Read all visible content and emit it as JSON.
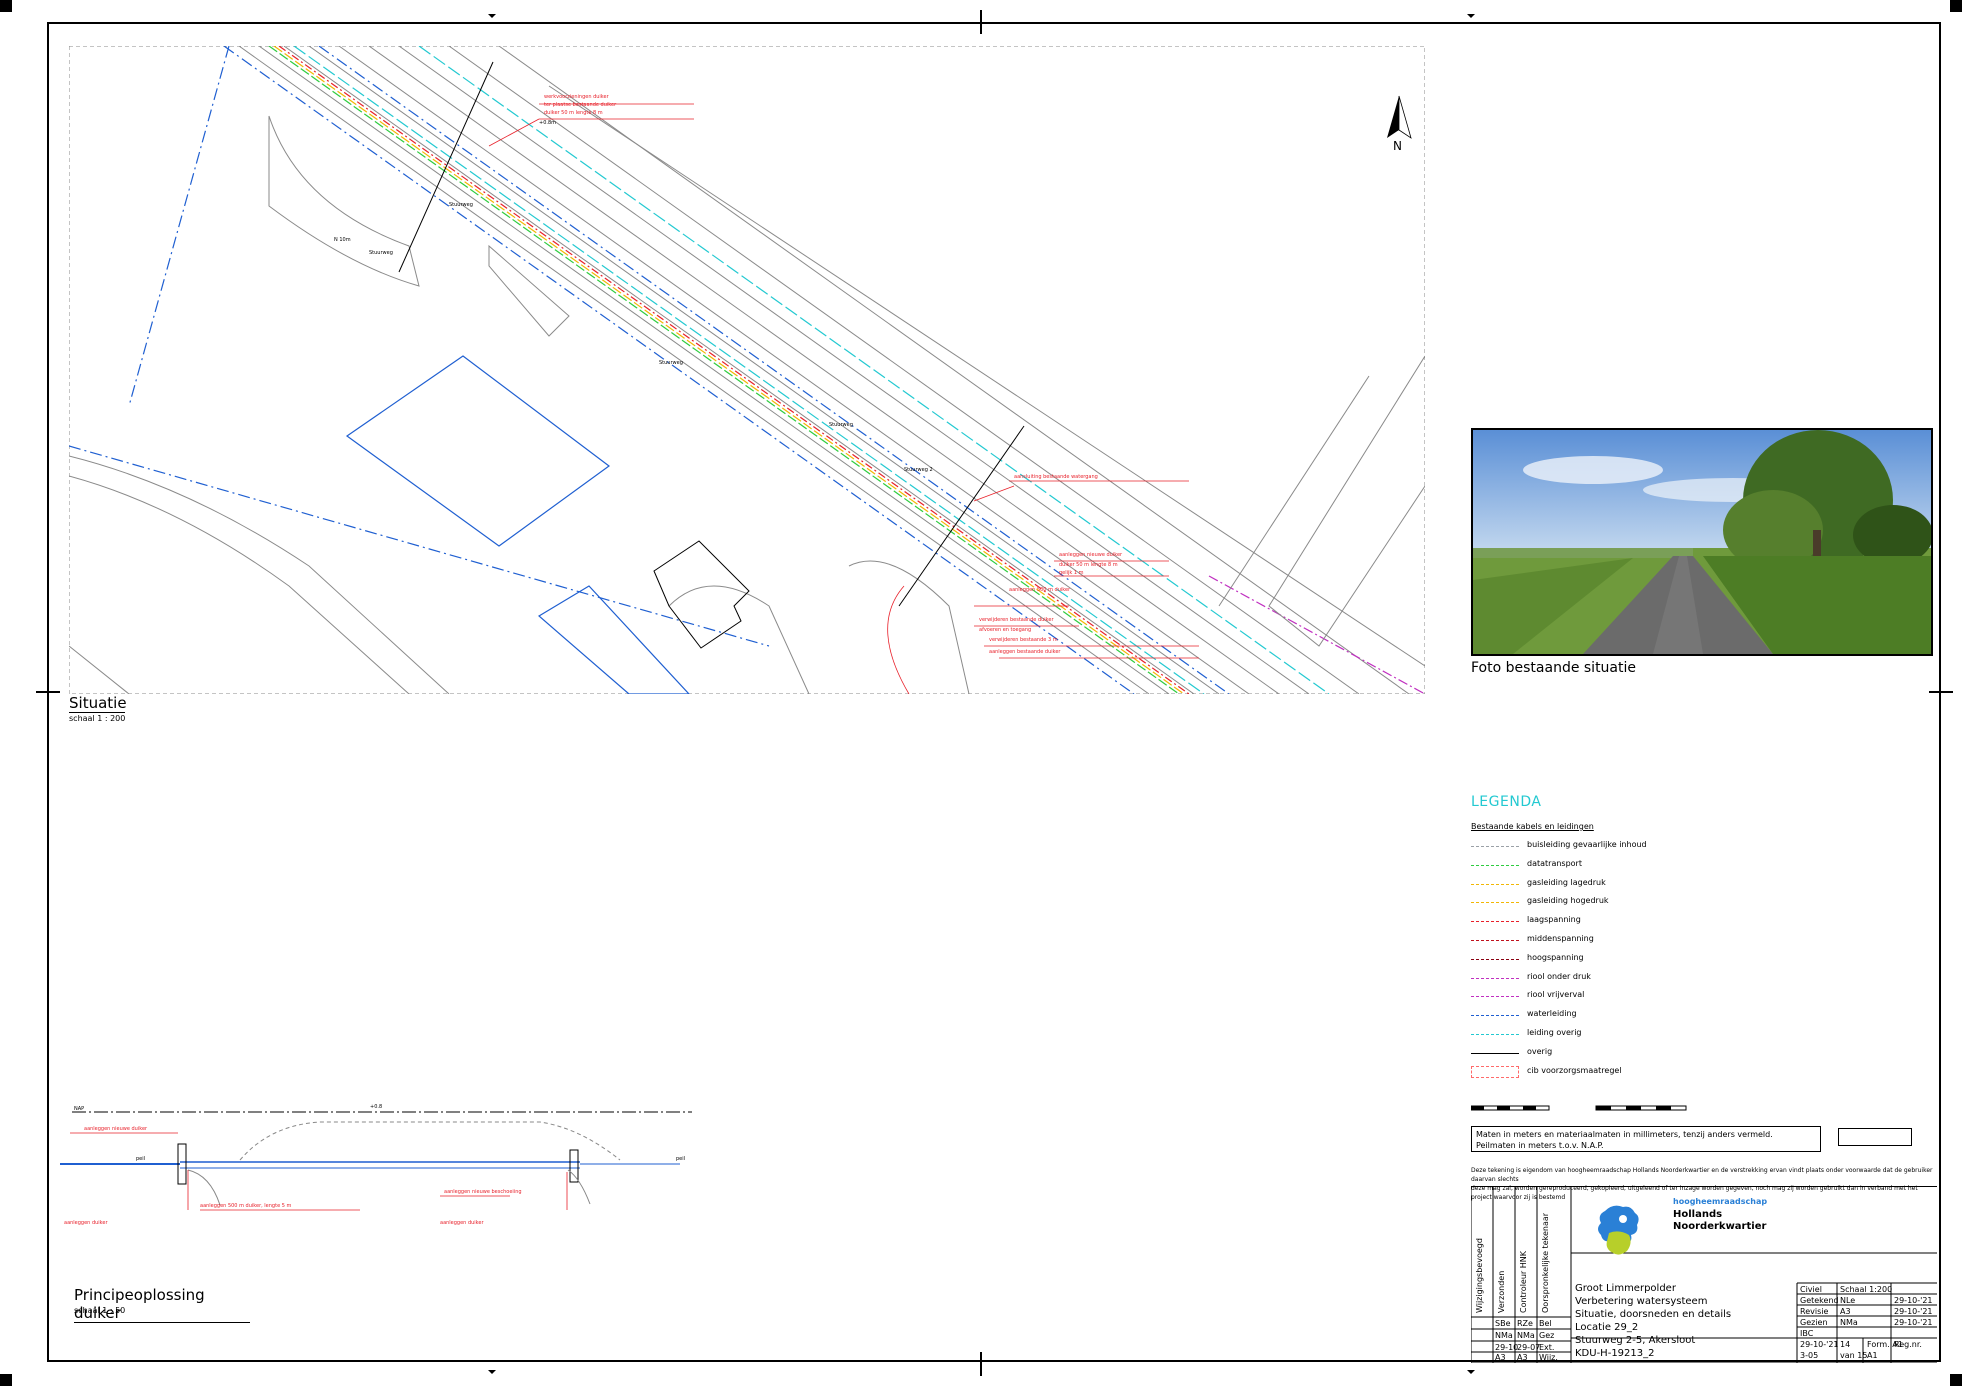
{
  "sheet": {
    "situatie_title": "Situatie",
    "situatie_scale": "schaal 1 : 200",
    "photo_caption": "Foto bestaande situatie",
    "principe_title": "Principeoplossing duiker",
    "principe_scale": "schaal 1 : 50",
    "north_label": "N"
  },
  "legend": {
    "title": "LEGENDA",
    "subtitle": "Bestaande kabels en leidingen",
    "items": [
      {
        "label": "buisleiding gevaarlijke inhoud",
        "color": "#9aa0a6"
      },
      {
        "label": "datatransport",
        "color": "#2ecc40"
      },
      {
        "label": "gasleiding lagedruk",
        "color": "#f2b705"
      },
      {
        "label": "gasleiding hogedruk",
        "color": "#f2b705"
      },
      {
        "label": "laagspanning",
        "color": "#e8202a"
      },
      {
        "label": "middenspanning",
        "color": "#c0101c"
      },
      {
        "label": "hoogspanning",
        "color": "#8b0010"
      },
      {
        "label": "riool onder druk",
        "color": "#c030c0"
      },
      {
        "label": "riool vrijverval",
        "color": "#c030c0"
      },
      {
        "label": "waterleiding",
        "color": "#1f5fd1"
      },
      {
        "label": "leiding overig",
        "color": "#23c9d1"
      },
      {
        "label": "overig",
        "color": "#000000"
      },
      {
        "label": "cib voorzorgsmaatregel",
        "color": "#ff6a6a"
      }
    ]
  },
  "notes": {
    "line1": "Maten in meters en materiaalmaten in millimeters, tenzij anders vermeld.",
    "line2": "Peilmaten in meters t.o.v. N.A.P.",
    "disclaimer1": "Deze tekening is eigendom van hoogheemraadschap Hollands Noorderkwartier en de verstrekking ervan vindt plaats onder voorwaarde dat de gebruiker daarvan slechts",
    "disclaimer2": "deze mag zal, worden gereproduceerd, gekopieerd, uitgeleend of ter inzage worden gegeven, noch mag zij worden gebruikt dan in verband met het project waarvoor zij is bestemd"
  },
  "titleblock": {
    "org_line1": "hoogheemraadschap",
    "org_line2": "Hollands",
    "org_line3": "Noorderkwartier",
    "project": [
      "Groot Limmerpolder",
      "Verbetering watersysteem",
      "Situatie, doorsneden en details",
      "Locatie 29_2",
      "Stuurweg 2-5, Akersloot",
      "KDU-H-19213_2"
    ],
    "side_labels": [
      "Wijzigingsbevoegd",
      "Verzonden",
      "Controleur HNK",
      "Oorspronkelijke tekenaar"
    ],
    "meta": [
      [
        "Civiel",
        "Schaal 1:200"
      ],
      [
        "Getekend",
        "NLe",
        "29-10-'21"
      ],
      [
        "Revisie",
        "A3",
        "29-10-'21"
      ],
      [
        "Gezien",
        "NMa",
        "29-10-'21"
      ],
      [
        "IBC",
        "",
        ""
      ]
    ],
    "bottom": [
      "29-10-'21",
      "3-05",
      "14",
      "Form. A1",
      "Reg.nr."
    ],
    "sheet_no": "14",
    "sheet_of": "van 15",
    "format": "A1",
    "row_sbe": [
      "SBe",
      "RZe",
      "Bel"
    ],
    "row_nma": [
      "NMa",
      "NMa",
      "Gez"
    ],
    "row_dates": [
      "29-10",
      "29-07",
      "Ext."
    ],
    "row_rev": [
      "A3",
      "A3",
      "Wijz."
    ]
  }
}
